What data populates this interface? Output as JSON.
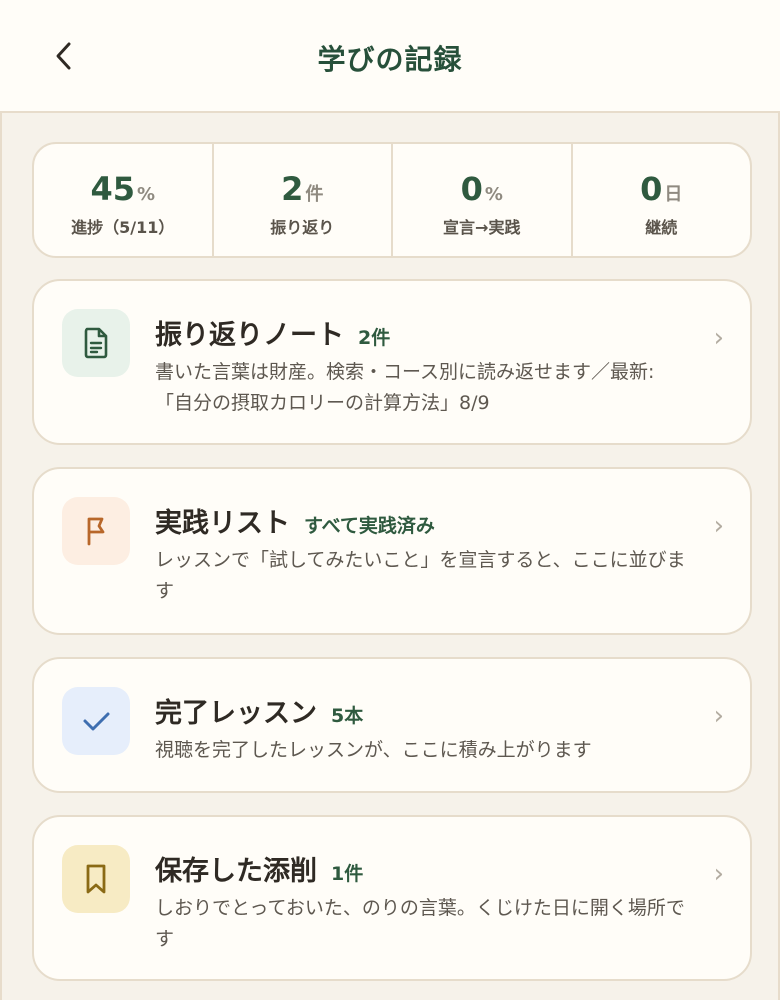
{
  "header": {
    "title": "学びの記録"
  },
  "stats": [
    {
      "value": "45",
      "unit": "%",
      "label": "進捗（5/11）"
    },
    {
      "value": "2",
      "unit": "件",
      "label": "振り返り"
    },
    {
      "value": "0",
      "unit": "%",
      "label": "宣言→実践"
    },
    {
      "value": "0",
      "unit": "日",
      "label": "継続"
    }
  ],
  "cards": [
    {
      "title": "振り返りノート",
      "badge": "2件",
      "desc": "書いた言葉は財産。検索・コース別に読み返せます／最新: 「自分の摂取カロリーの計算方法」8/9",
      "icon": "document-icon"
    },
    {
      "title": "実践リスト",
      "badge": "すべて実践済み",
      "desc": "レッスンで「試してみたいこと」を宣言すると、ここに並びます",
      "icon": "flag-icon"
    },
    {
      "title": "完了レッスン",
      "badge": "5本",
      "desc": "視聴を完了したレッスンが、ここに積み上がります",
      "icon": "check-icon"
    },
    {
      "title": "保存した添削",
      "badge": "1件",
      "desc": "しおりでとっておいた、のりの言葉。くじけた日に開く場所です",
      "icon": "bookmark-icon"
    }
  ],
  "colors": {
    "accent": "#2f5a3f",
    "background": "#f6f2ea",
    "card": "#fffdf8",
    "icon_bg_note": "#e8f2ea",
    "icon_bg_flag": "#fdeee2",
    "icon_bg_check": "#e6eefb",
    "icon_bg_bookmark": "#f7ebc4"
  }
}
